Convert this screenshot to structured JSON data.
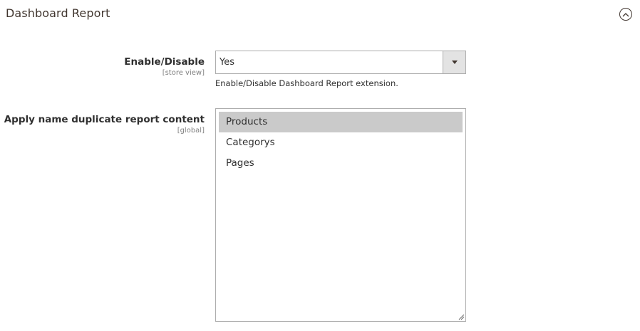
{
  "section": {
    "title": "Dashboard Report",
    "toggle_icon": "chevron-up-circle-icon"
  },
  "fields": {
    "enable": {
      "label": "Enable/Disable",
      "scope": "[store view]",
      "value": "Yes",
      "note": "Enable/Disable Dashboard Report extension."
    },
    "duplicate": {
      "label": "Apply name duplicate report content",
      "scope": "[global]",
      "options": [
        "Products",
        "Categorys",
        "Pages"
      ],
      "selected": "Products"
    }
  },
  "colors": {
    "selected_bg": "#cacaca",
    "border": "#adadad",
    "arrow_bg": "#e3e3e3"
  }
}
